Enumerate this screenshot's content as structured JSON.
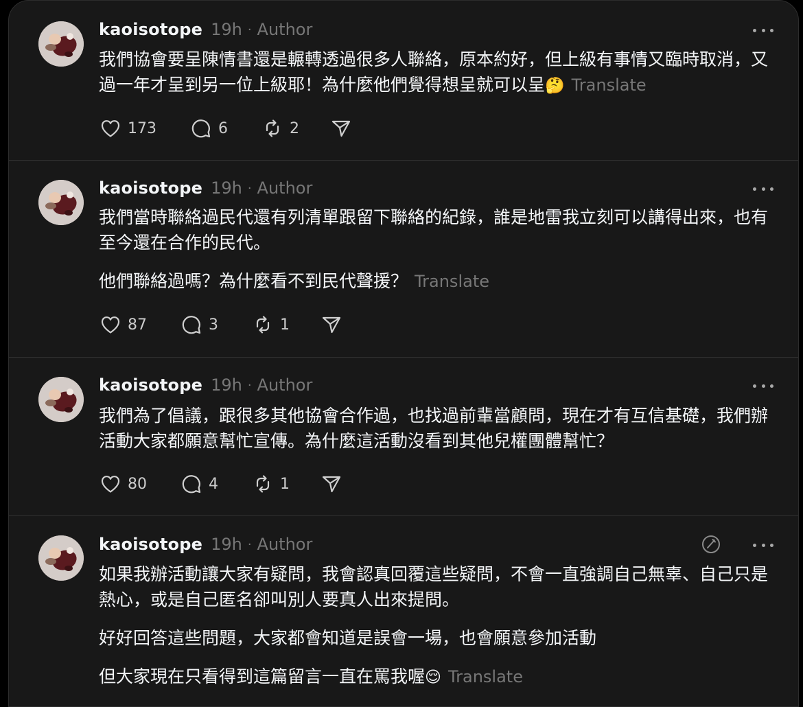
{
  "posts": [
    {
      "username": "kaoisotope",
      "time": "19h",
      "separator": "·",
      "author_tag": "Author",
      "paragraphs": [
        "我們協會要呈陳情書還是輾轉透過很多人聯絡，原本約好，但上級有事情又臨時取消，又過一年才呈到另一位上級耶！為什麼他們覺得想呈就可以呈"
      ],
      "emoji": "🤔",
      "translate": "Translate",
      "likes": "173",
      "replies": "6",
      "reposts": "2"
    },
    {
      "username": "kaoisotope",
      "time": "19h",
      "separator": "·",
      "author_tag": "Author",
      "paragraphs": [
        "我們當時聯絡過民代還有列清單跟留下聯絡的紀錄，誰是地雷我立刻可以講得出來，也有至今還在合作的民代。",
        "他們聯絡過嗎？為什麼看不到民代聲援？"
      ],
      "translate": "Translate",
      "likes": "87",
      "replies": "3",
      "reposts": "1"
    },
    {
      "username": "kaoisotope",
      "time": "19h",
      "separator": "·",
      "author_tag": "Author",
      "paragraphs": [
        "我們為了倡議，跟很多其他協會合作過，也找過前輩當顧問，現在才有互信基礎，我們辦活動大家都願意幫忙宣傳。為什麼這活動沒看到其他兒權團體幫忙？"
      ],
      "likes": "80",
      "replies": "4",
      "reposts": "1"
    },
    {
      "username": "kaoisotope",
      "time": "19h",
      "separator": "·",
      "author_tag": "Author",
      "paragraphs": [
        "如果我辦活動讓大家有疑問，我會認真回覆這些疑問，不會一直強調自己無辜、自己只是熱心，或是自己匿名卻叫別人要真人出來提問。",
        "好好回答這些問題，大家都會知道是誤會一場，也會願意參加活動",
        "但大家現在只看得到這篇留言一直在罵我喔"
      ],
      "emoji": "😌",
      "translate": "Translate"
    }
  ],
  "icons": {
    "like": "heart-icon",
    "reply": "comment-icon",
    "repost": "repost-icon",
    "share": "send-icon",
    "more": "more-icon",
    "edited": "edit-icon"
  },
  "colors": {
    "background": "#181818",
    "text": "#f3f5f7",
    "muted": "#777777",
    "divider": "#323232"
  }
}
